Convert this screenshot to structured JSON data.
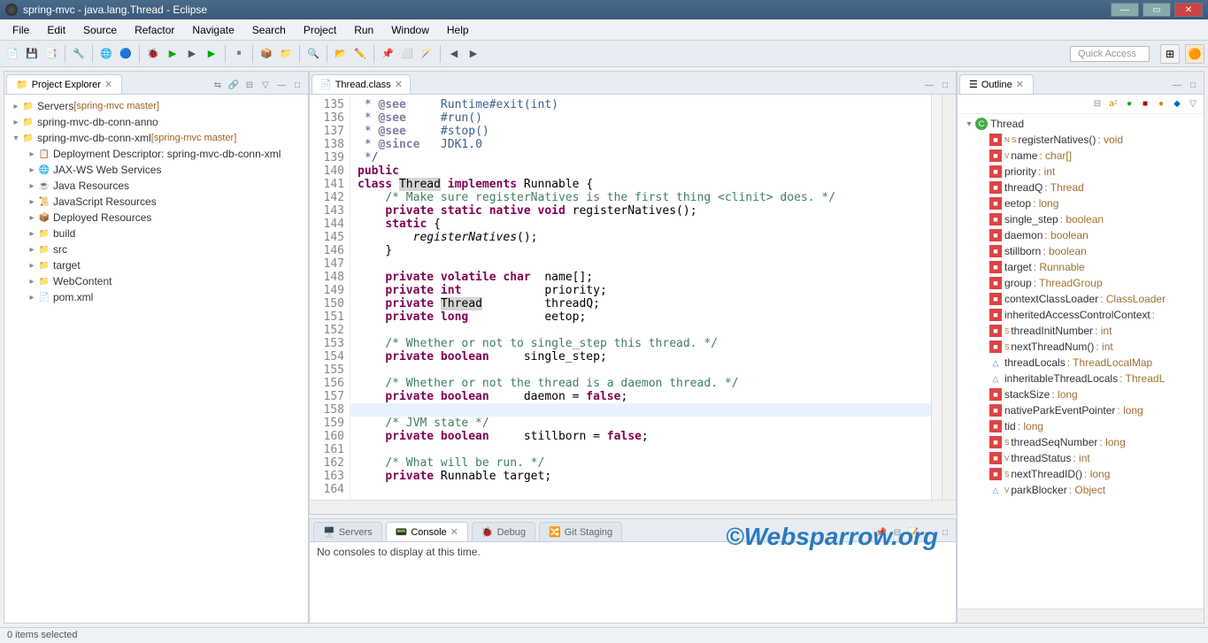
{
  "window": {
    "title": "spring-mvc - java.lang.Thread - Eclipse"
  },
  "menu": [
    "File",
    "Edit",
    "Source",
    "Refactor",
    "Navigate",
    "Search",
    "Project",
    "Run",
    "Window",
    "Help"
  ],
  "quick_access": "Quick Access",
  "project_explorer": {
    "title": "Project Explorer",
    "items": [
      {
        "label": "Servers",
        "decor": " [spring-mvc master]",
        "indent": 0,
        "icon": "folder"
      },
      {
        "label": "spring-mvc-db-conn-anno",
        "decor": "",
        "indent": 0,
        "icon": "folder"
      },
      {
        "label": "spring-mvc-db-conn-xml",
        "decor": " [spring-mvc master]",
        "indent": 0,
        "icon": "folder",
        "expanded": true
      },
      {
        "label": "Deployment Descriptor: spring-mvc-db-conn-xml",
        "decor": "",
        "indent": 1,
        "icon": "dd"
      },
      {
        "label": "JAX-WS Web Services",
        "decor": "",
        "indent": 1,
        "icon": "ws"
      },
      {
        "label": "Java Resources",
        "decor": "",
        "indent": 1,
        "icon": "jr"
      },
      {
        "label": "JavaScript Resources",
        "decor": "",
        "indent": 1,
        "icon": "js"
      },
      {
        "label": "Deployed Resources",
        "decor": "",
        "indent": 1,
        "icon": "dep"
      },
      {
        "label": "build",
        "decor": "",
        "indent": 1,
        "icon": "folder"
      },
      {
        "label": "src",
        "decor": "",
        "indent": 1,
        "icon": "folder"
      },
      {
        "label": "target",
        "decor": "",
        "indent": 1,
        "icon": "folder"
      },
      {
        "label": "WebContent",
        "decor": "",
        "indent": 1,
        "icon": "folder"
      },
      {
        "label": "pom.xml",
        "decor": "",
        "indent": 1,
        "icon": "xml"
      }
    ]
  },
  "editor": {
    "tab": "Thread.class",
    "first_line": 135,
    "lines": [
      " * <span class='tag'>@see</span>     Runtime#exit(int)",
      " * <span class='tag'>@see</span>     #run()",
      " * <span class='tag'>@see</span>     #stop()",
      " * <span class='tag'>@since</span>   JDK1.0",
      " */",
      "<span class='kw'>public</span>",
      "<span class='kw'>class</span> <span class='hl'>Thread</span> <span class='kw'>implements</span> Runnable {",
      "    <span class='cm'>/* Make sure registerNatives is the first thing &lt;clinit&gt; does. */</span>",
      "    <span class='kw'>private static native void</span> registerNatives();",
      "    <span class='kw'>static</span> {",
      "        <span style='font-style:italic'>registerNatives</span>();",
      "    }",
      "",
      "    <span class='kw'>private volatile char</span>  name[];",
      "    <span class='kw'>private int</span>            priority;",
      "    <span class='kw'>private</span> <span class='hl'>Thread</span>         threadQ;",
      "    <span class='kw'>private long</span>           eetop;",
      "",
      "    <span class='cm'>/* Whether or not to single_step this thread. */</span>",
      "    <span class='kw'>private boolean</span>     single_step;",
      "",
      "    <span class='cm'>/* Whether or not the thread is a daemon thread. */</span>",
      "    <span class='kw'>private boolean</span>     daemon = <span class='kw'>false</span>;",
      "",
      "    <span class='cm'>/* JVM state */</span>",
      "    <span class='kw'>private boolean</span>     stillborn = <span class='kw'>false</span>;",
      "",
      "    <span class='cm'>/* What will be run. */</span>",
      "    <span class='kw'>private</span> Runnable target;",
      ""
    ],
    "cursor_line_index": 23
  },
  "outline": {
    "title": "Outline",
    "root": "Thread",
    "members": [
      {
        "name": "registerNatives()",
        "type": ": void",
        "ic": "red-sq",
        "sup": "N S"
      },
      {
        "name": "name",
        "type": ": char[]",
        "ic": "red-sq",
        "sup": "V"
      },
      {
        "name": "priority",
        "type": ": int",
        "ic": "red-sq"
      },
      {
        "name": "threadQ",
        "type": ": Thread",
        "ic": "red-sq"
      },
      {
        "name": "eetop",
        "type": ": long",
        "ic": "red-sq"
      },
      {
        "name": "single_step",
        "type": ": boolean",
        "ic": "red-sq"
      },
      {
        "name": "daemon",
        "type": ": boolean",
        "ic": "red-sq"
      },
      {
        "name": "stillborn",
        "type": ": boolean",
        "ic": "red-sq"
      },
      {
        "name": "target",
        "type": ": Runnable",
        "ic": "red-sq"
      },
      {
        "name": "group",
        "type": ": ThreadGroup",
        "ic": "red-sq"
      },
      {
        "name": "contextClassLoader",
        "type": ": ClassLoader",
        "ic": "red-sq"
      },
      {
        "name": "inheritedAccessControlContext",
        "type": ": ",
        "ic": "red-sq"
      },
      {
        "name": "threadInitNumber",
        "type": ": int",
        "ic": "red-sq",
        "sup": "S"
      },
      {
        "name": "nextThreadNum()",
        "type": ": int",
        "ic": "red-sq",
        "sup": "S"
      },
      {
        "name": "threadLocals",
        "type": ": ThreadLocalMap",
        "ic": "blue-tri"
      },
      {
        "name": "inheritableThreadLocals",
        "type": ": ThreadL",
        "ic": "blue-tri"
      },
      {
        "name": "stackSize",
        "type": ": long",
        "ic": "red-sq"
      },
      {
        "name": "nativeParkEventPointer",
        "type": ": long",
        "ic": "red-sq"
      },
      {
        "name": "tid",
        "type": ": long",
        "ic": "red-sq"
      },
      {
        "name": "threadSeqNumber",
        "type": ": long",
        "ic": "red-sq",
        "sup": "S"
      },
      {
        "name": "threadStatus",
        "type": ": int",
        "ic": "red-sq",
        "sup": "V"
      },
      {
        "name": "nextThreadID()",
        "type": ": long",
        "ic": "red-sq",
        "sup": "S"
      },
      {
        "name": "parkBlocker",
        "type": ": Object",
        "ic": "blue-tri",
        "sup": "V"
      }
    ]
  },
  "bottom": {
    "tabs": [
      "Servers",
      "Console",
      "Debug",
      "Git Staging"
    ],
    "active": 1,
    "message": "No consoles to display at this time.",
    "watermark": "©Websparrow.org"
  },
  "statusbar": "0 items selected"
}
